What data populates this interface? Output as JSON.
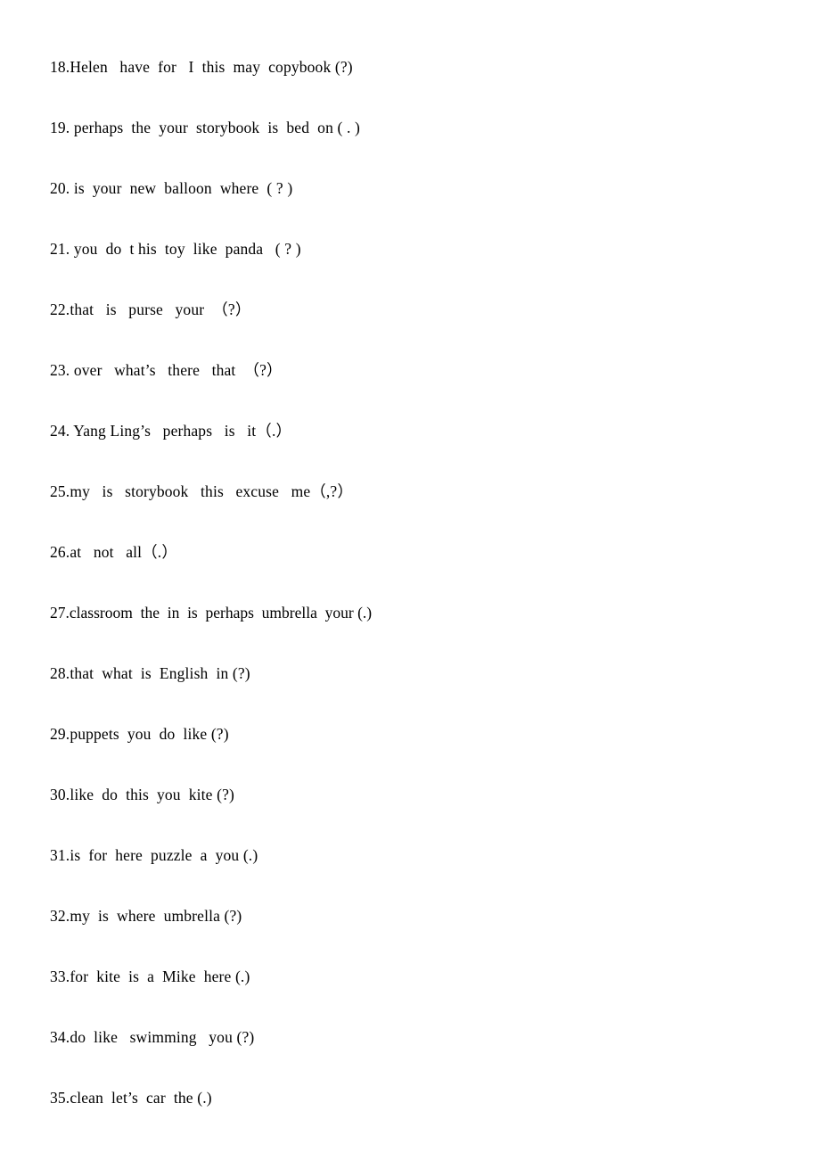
{
  "document": {
    "type": "worksheet",
    "page_background": "#ffffff",
    "text_color": "#000000",
    "exercise_lines": [
      {
        "number": "18.",
        "text": "18.Helen   have  for   I  this  may  copybook (?)"
      },
      {
        "number": "19.",
        "text": "19. perhaps  the  your  storybook  is  bed  on ( . )"
      },
      {
        "number": "20.",
        "text": "20. is  your  new  balloon  where  ( ? )"
      },
      {
        "number": "21.",
        "text": "21. you  do  t his  toy  like  panda   ( ? )"
      },
      {
        "number": "22.",
        "text": "22.that   is   purse   your  （?）"
      },
      {
        "number": "23.",
        "text": "23. over   what’s   there   that  （?）"
      },
      {
        "number": "24.",
        "text": "24. Yang Ling’s   perhaps   is   it（.）"
      },
      {
        "number": "25.",
        "text": "25.my   is   storybook   this   excuse   me（,?）"
      },
      {
        "number": "26.",
        "text": "26.at   not   all（.）"
      },
      {
        "number": "27.",
        "text": "27.classroom  the  in  is  perhaps  umbrella  your (.)"
      },
      {
        "number": "28.",
        "text": "28.that  what  is  English  in (?)"
      },
      {
        "number": "29.",
        "text": "29.puppets  you  do  like (?)"
      },
      {
        "number": "30.",
        "text": "30.like  do  this  you  kite (?)"
      },
      {
        "number": "31.",
        "text": "31.is  for  here  puzzle  a  you (.)"
      },
      {
        "number": "32.",
        "text": "32.my  is  where  umbrella (?)"
      },
      {
        "number": "33.",
        "text": "33.for  kite  is  a  Mike  here (.)"
      },
      {
        "number": "34.",
        "text": "34.do  like   swimming   you (?)"
      },
      {
        "number": "35.",
        "text": "35.clean  let’s  car  the (.)"
      }
    ]
  }
}
